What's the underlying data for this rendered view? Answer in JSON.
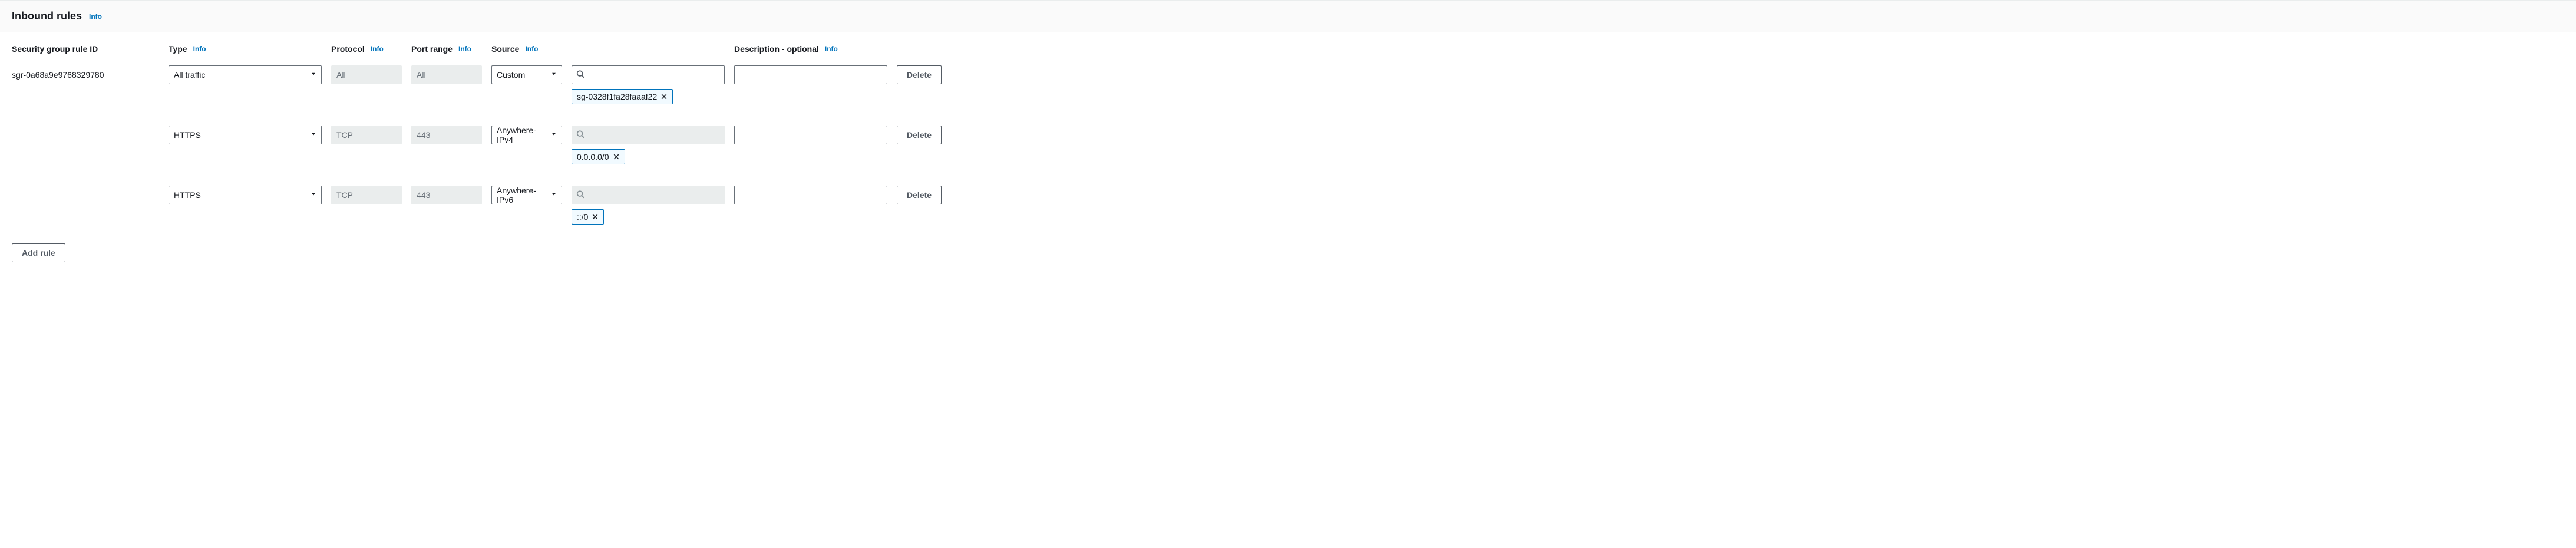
{
  "header": {
    "title": "Inbound rules",
    "info": "Info"
  },
  "columns": {
    "rule_id": "Security group rule ID",
    "type": "Type",
    "type_info": "Info",
    "protocol": "Protocol",
    "protocol_info": "Info",
    "port_range": "Port range",
    "port_range_info": "Info",
    "source": "Source",
    "source_info": "Info",
    "description": "Description - optional",
    "description_info": "Info"
  },
  "rules": [
    {
      "rule_id": "sgr-0a68a9e9768329780",
      "type": "All traffic",
      "protocol": "All",
      "port_range": "All",
      "source_type": "Custom",
      "source_search_enabled": true,
      "source_tokens": [
        "sg-0328f1fa28faaaf22"
      ],
      "description": ""
    },
    {
      "rule_id": "–",
      "type": "HTTPS",
      "protocol": "TCP",
      "port_range": "443",
      "source_type": "Anywhere-IPv4",
      "source_search_enabled": false,
      "source_tokens": [
        "0.0.0.0/0"
      ],
      "description": ""
    },
    {
      "rule_id": "–",
      "type": "HTTPS",
      "protocol": "TCP",
      "port_range": "443",
      "source_type": "Anywhere-IPv6",
      "source_search_enabled": false,
      "source_tokens": [
        "::/0"
      ],
      "description": ""
    }
  ],
  "buttons": {
    "delete": "Delete",
    "add_rule": "Add rule"
  }
}
